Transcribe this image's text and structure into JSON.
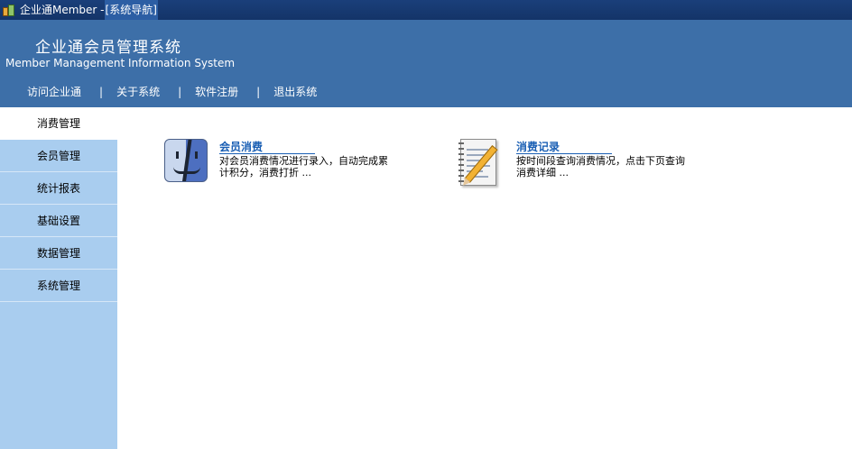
{
  "window": {
    "title_prefix": "企业通Member - ",
    "title_highlight": "[系统导航]"
  },
  "header": {
    "cn_title": "企业通会员管理系统",
    "en_title": "Member Management Information System",
    "nav": [
      {
        "label": "访问企业通"
      },
      {
        "label": "关于系统"
      },
      {
        "label": "软件注册"
      },
      {
        "label": "退出系统"
      }
    ],
    "separator": "|"
  },
  "sidebar": {
    "items": [
      {
        "label": "消费管理",
        "active": true
      },
      {
        "label": "会员管理"
      },
      {
        "label": "统计报表"
      },
      {
        "label": "基础设置"
      },
      {
        "label": "数据管理"
      },
      {
        "label": "系统管理"
      }
    ]
  },
  "main": {
    "cards": [
      {
        "title": "会员消费",
        "desc_line1": "对会员消费情况进行录入，自动完成累",
        "desc_line2": "计积分，消费打折 ...",
        "icon": "finder-face-icon"
      },
      {
        "title": "消费记录",
        "desc_line1": "按时间段查询消费情况，点击下页查询",
        "desc_line2": "消费详细 ...",
        "icon": "notepad-pencil-icon"
      }
    ]
  },
  "colors": {
    "header_bg": "#3d6fa8",
    "sidebar_bg": "#a9cdef",
    "link": "#1a5fb4"
  }
}
